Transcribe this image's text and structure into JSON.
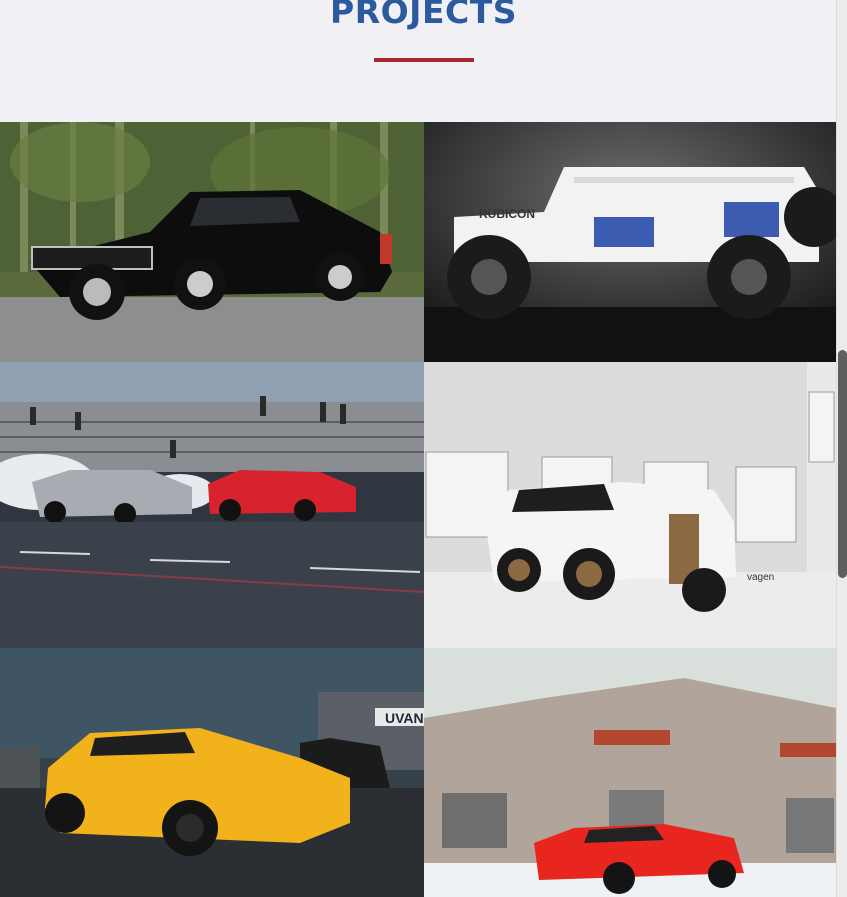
{
  "section": {
    "title": "PROJECTS"
  },
  "colors": {
    "title": "#2b5a9e",
    "underline": "#a8282e",
    "background": "#f1f0f4"
  },
  "projects": [
    {
      "label": "black classic muscle car on road",
      "car_color": "#0d0d0d"
    },
    {
      "label": "white doorless jeep wrangler rubicon in studio",
      "car_color": "#f2f2f2",
      "text": "RUBICON"
    },
    {
      "label": "two muscle cars doing burnouts at drag strip",
      "car_color": "#d8232e"
    },
    {
      "label": "white suv with bronze stripes at warehouse",
      "car_color": "#f5f5f5",
      "text": "vagen"
    },
    {
      "label": "yellow sedan in parking lot",
      "car_color": "#f2b21b",
      "text": "UVAN"
    },
    {
      "label": "red coupe in front of brick building",
      "car_color": "#e8261f"
    }
  ]
}
